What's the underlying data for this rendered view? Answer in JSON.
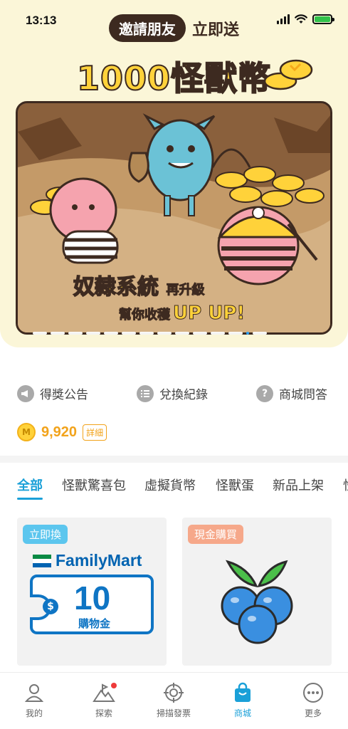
{
  "status_bar": {
    "time": "13:13"
  },
  "promo": {
    "invite_pill": "邀請朋友",
    "invite_send": "立即送",
    "big_title": "1000怪獸幣",
    "banner_line1": "奴隸系統",
    "banner_line1_small": "再升級",
    "banner_line2": "幫你收穫",
    "banner_line2_big": "UP UP!",
    "slide_count": 14,
    "active_slide": 12
  },
  "links": [
    {
      "label": "得獎公告",
      "icon": "megaphone-icon"
    },
    {
      "label": "兌換紀錄",
      "icon": "list-icon"
    },
    {
      "label": "商城問答",
      "icon": "question-icon"
    }
  ],
  "balance": {
    "amount": "9,920",
    "detail_label": "詳細",
    "coin_letter": "M"
  },
  "tabs": [
    "全部",
    "怪獸驚喜包",
    "虛擬貨幣",
    "怪獸蛋",
    "新品上架",
    "怪"
  ],
  "active_tab": 0,
  "cards": [
    {
      "tag": "立即換",
      "tag_color": "#5cc6ee",
      "brand": "FamilyMart",
      "voucher_currency": "$",
      "voucher_amount": "10",
      "voucher_label": "購物金"
    },
    {
      "tag": "現金購買",
      "tag_color": "#f6a88a"
    }
  ],
  "bottom_nav": [
    {
      "label": "我的",
      "icon": "person-icon"
    },
    {
      "label": "探索",
      "icon": "flag-mountain-icon",
      "badge": true
    },
    {
      "label": "掃描發票",
      "icon": "target-scan-icon"
    },
    {
      "label": "商城",
      "icon": "shopping-bag-icon",
      "active": true
    },
    {
      "label": "更多",
      "icon": "more-icon"
    }
  ],
  "colors": {
    "accent": "#1aa0d8",
    "coin": "#f2a31b",
    "hero_bg": "#fbf6d8",
    "familymart_blue": "#0f75c4"
  }
}
